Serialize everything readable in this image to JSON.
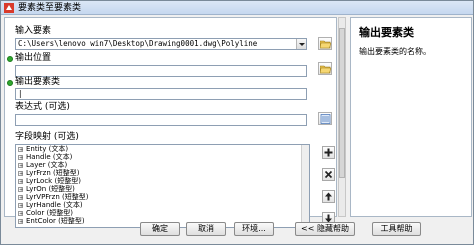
{
  "window": {
    "title": "要素类至要素类"
  },
  "fields": {
    "input_features": {
      "label": "输入要素",
      "value": "C:\\Users\\lenovo win7\\Desktop\\Drawing0001.dwg\\Polyline"
    },
    "output_location": {
      "label": "输出位置",
      "value": ""
    },
    "output_feature_class": {
      "label": "输出要素类",
      "value": "|"
    },
    "expression": {
      "label": "表达式 (可选)",
      "value": ""
    },
    "field_map": {
      "label": "字段映射 (可选)",
      "items": [
        "Entity (文本)",
        "Handle (文本)",
        "Layer (文本)",
        "LyrFrzn (短整型)",
        "LyrLock (短整型)",
        "LyrOn (短整型)",
        "LyrVPFrzn (短整型)",
        "LyrHandle (文本)",
        "Color (短整型)",
        "EntColor (短整型)"
      ]
    }
  },
  "help": {
    "title": "输出要素类",
    "body": "输出要素类的名称。"
  },
  "buttons": {
    "ok": "确定",
    "cancel": "取消",
    "environments": "环境...",
    "hide_help": "<< 隐藏帮助",
    "tool_help": "工具帮助"
  },
  "colors": {
    "required_dot": "#2fa82f",
    "titlebar": "#c5d7ef"
  }
}
